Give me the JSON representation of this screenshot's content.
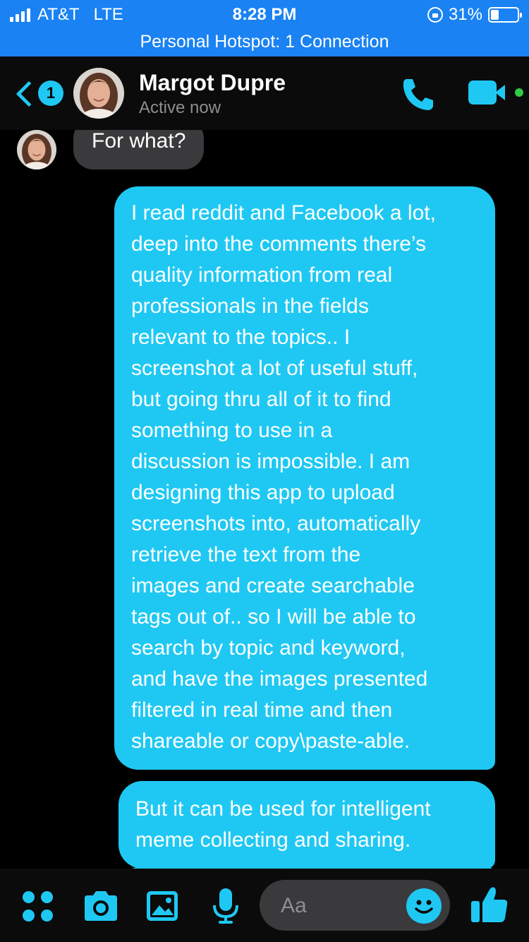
{
  "status_bar": {
    "carrier": "AT&T",
    "network": "LTE",
    "time": "8:28 PM",
    "battery_percent": "31%",
    "battery_level": 0.31,
    "hotspot_text": "Personal Hotspot: 1 Connection"
  },
  "header": {
    "back_badge_count": "1",
    "contact_name": "Margot Dupre",
    "contact_status": "Active now",
    "icons": [
      "back-chevron-icon",
      "phone-icon",
      "video-camera-icon",
      "active-dot-icon"
    ]
  },
  "messages": {
    "incoming": {
      "text": "For what?"
    },
    "outgoing_1": {
      "lines": [
        "I read reddit and Facebook a lot,",
        "deep into the comments there’s",
        "quality information from real",
        "professionals in the fields",
        "relevant to the topics.. I",
        "screenshot a lot of useful stuff,",
        "but going thru all of it to find",
        "something to use in a",
        "discussion is impossible. I am",
        "designing this app to upload",
        "screenshots into, automatically",
        "retrieve the text from the",
        "images and create searchable",
        "tags out of.. so I will be able to",
        "search by topic and keyword,",
        "and have the images presented",
        "filtered in real time and then",
        "shareable or copy\\paste-able."
      ]
    },
    "outgoing_2": {
      "lines": [
        "But it can be used for intelligent",
        "meme collecting and sharing."
      ]
    }
  },
  "composer": {
    "placeholder": "Aa",
    "icons": [
      "apps-icon",
      "camera-icon",
      "gallery-icon",
      "microphone-icon",
      "emoji-icon",
      "thumbs-up-icon"
    ]
  },
  "colors": {
    "accent": "#1fc8f3",
    "status_bar_blue": "#1a82f2",
    "incoming_bubble": "#3a3a3c",
    "active_green": "#31cc46"
  }
}
